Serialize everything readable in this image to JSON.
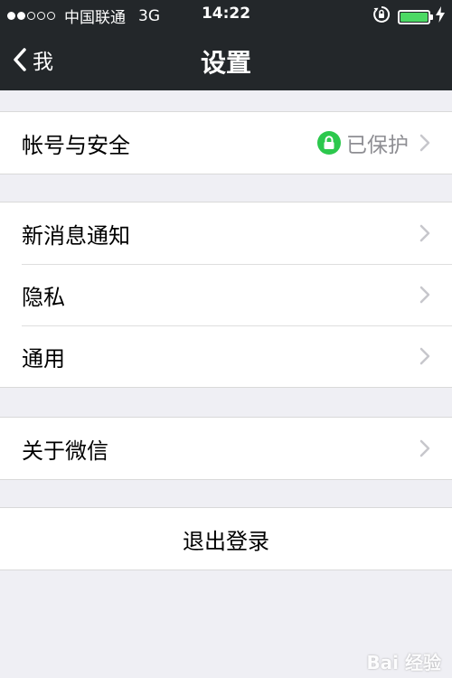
{
  "status_bar": {
    "signal_dots_filled": 2,
    "signal_dots_total": 5,
    "carrier": "中国联通",
    "network": "3G",
    "time": "14:22",
    "battery_level": 1.0,
    "battery_color": "#4cd964",
    "icons": [
      "rotation-lock-icon",
      "charging-bolt-icon"
    ]
  },
  "nav": {
    "back_label": "我",
    "title": "设置"
  },
  "groups": [
    {
      "items": [
        {
          "label": "帐号与安全",
          "value": "已保护",
          "icon": "lock-icon"
        }
      ]
    },
    {
      "items": [
        {
          "label": "新消息通知"
        },
        {
          "label": "隐私"
        },
        {
          "label": "通用"
        }
      ]
    },
    {
      "items": [
        {
          "label": "关于微信"
        }
      ]
    }
  ],
  "logout_label": "退出登录",
  "watermark": "Bai 经验"
}
